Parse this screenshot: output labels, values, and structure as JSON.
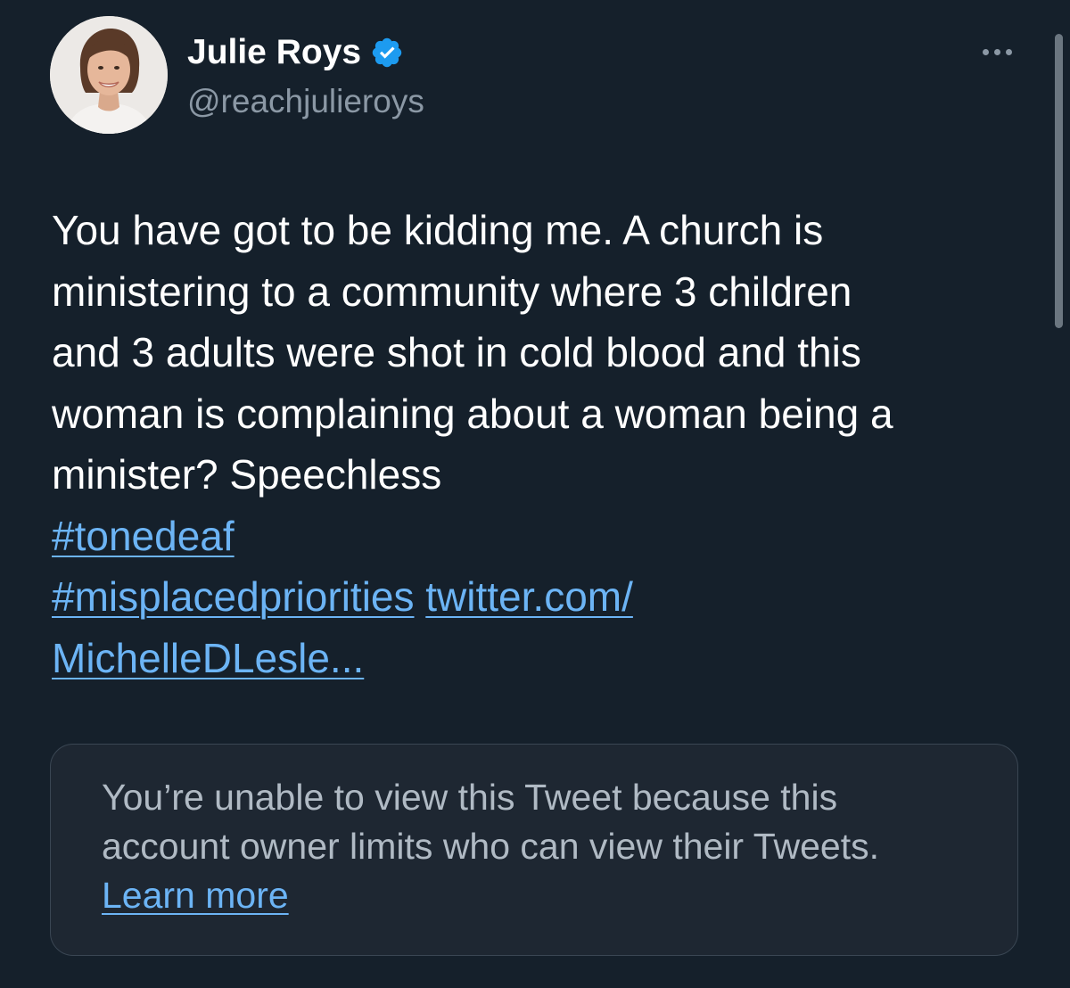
{
  "author": {
    "display_name": "Julie Roys",
    "handle": "@reachjulieroys",
    "verified": true,
    "avatar_icon": "profile-photo"
  },
  "more_icon": "more-horizontal-icon",
  "tweet": {
    "lines": [
      "You have got to be kidding me. A church is",
      "ministering to a community where 3 children",
      "and 3 adults were shot in cold blood and this",
      "woman is complaining about a woman being a",
      "minister? Speechless"
    ],
    "hashtag_1": "#tonedeaf",
    "hashtag_2": "#misplacedpriorities",
    "link_part_1": "twitter.com/",
    "link_part_2": "MichelleDLesle..."
  },
  "quoted_notice": {
    "line_1": "You’re unable to view this Tweet because this",
    "line_2": "account owner limits who can view their Tweets.",
    "learn_more": "Learn more"
  },
  "colors": {
    "background": "#15202b",
    "link": "#6cb4f5",
    "secondary_text": "#8b98a5",
    "verified": "#1d9bf0"
  }
}
